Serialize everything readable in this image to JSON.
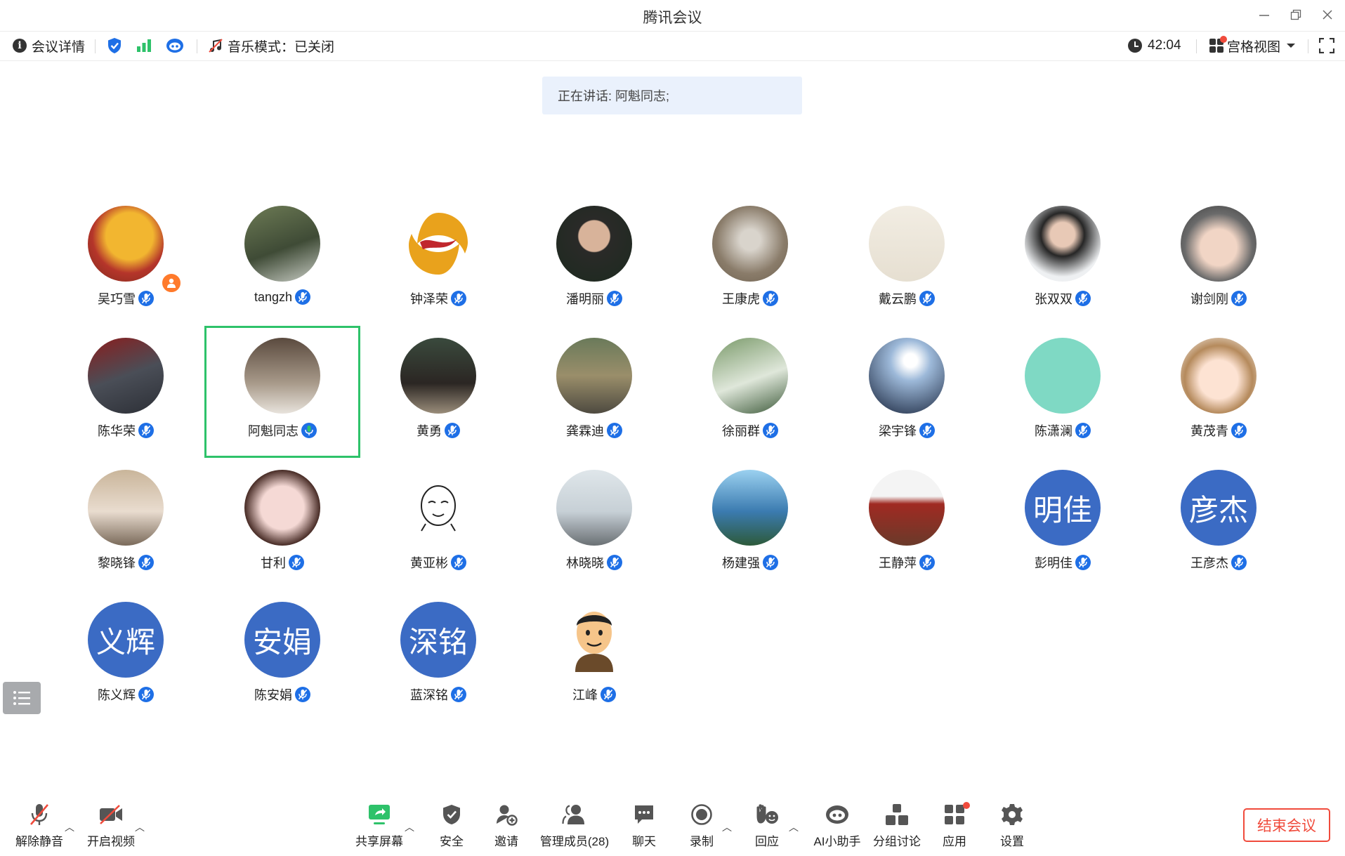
{
  "window": {
    "title": "腾讯会议"
  },
  "infobar": {
    "details_label": "会议详情",
    "music_mode_label": "音乐模式：已关闭",
    "timer": "42:04",
    "view_label": "宫格视图"
  },
  "speaking": {
    "text": "正在讲话: 阿魁同志;"
  },
  "participants": [
    {
      "name": "吴巧雪",
      "avatar": "photo"
    },
    {
      "name": "tangzh",
      "avatar": "photo"
    },
    {
      "name": "钟泽荣",
      "avatar": "photo"
    },
    {
      "name": "潘明丽",
      "avatar": "photo"
    },
    {
      "name": "王康虎",
      "avatar": "photo"
    },
    {
      "name": "戴云鹏",
      "avatar": "photo"
    },
    {
      "name": "张双双",
      "avatar": "photo"
    },
    {
      "name": "谢剑刚",
      "avatar": "photo"
    },
    {
      "name": "陈华荣",
      "avatar": "photo"
    },
    {
      "name": "阿魁同志",
      "avatar": "photo"
    },
    {
      "name": "黄勇",
      "avatar": "photo"
    },
    {
      "name": "龚霖迪",
      "avatar": "photo"
    },
    {
      "name": "徐丽群",
      "avatar": "photo"
    },
    {
      "name": "梁宇锋",
      "avatar": "photo"
    },
    {
      "name": "陈潇澜",
      "avatar": "photo"
    },
    {
      "name": "黄茂青",
      "avatar": "photo"
    },
    {
      "name": "黎晓锋",
      "avatar": "photo"
    },
    {
      "name": "甘利",
      "avatar": "photo"
    },
    {
      "name": "黄亚彬",
      "avatar": "photo"
    },
    {
      "name": "林晓晓",
      "avatar": "photo"
    },
    {
      "name": "杨建强",
      "avatar": "photo"
    },
    {
      "name": "王静萍",
      "avatar": "photo"
    },
    {
      "name": "彭明佳",
      "avatar_text": "明佳"
    },
    {
      "name": "王彦杰",
      "avatar_text": "彦杰"
    },
    {
      "name": "陈义辉",
      "avatar_text": "义辉"
    },
    {
      "name": "陈安娟",
      "avatar_text": "安娟"
    },
    {
      "name": "蓝深铭",
      "avatar_text": "深铭"
    },
    {
      "name": "江峰",
      "avatar": "photo"
    }
  ],
  "toolbar": {
    "unmute": "解除静音",
    "start_video": "开启视频",
    "share_screen": "共享屏幕",
    "security": "安全",
    "invite": "邀请",
    "manage_members": "管理成员(28)",
    "chat": "聊天",
    "record": "录制",
    "reactions": "回应",
    "ai_assistant": "AI小助手",
    "breakout": "分组讨论",
    "apps": "应用",
    "settings": "设置",
    "end_meeting": "结束会议"
  },
  "colors": {
    "accent": "#1e6fe6",
    "text_avatar": "#3b6bc4",
    "active_border": "#2ec26a",
    "danger": "#f04b3c",
    "host_badge": "#ff7a2b"
  }
}
